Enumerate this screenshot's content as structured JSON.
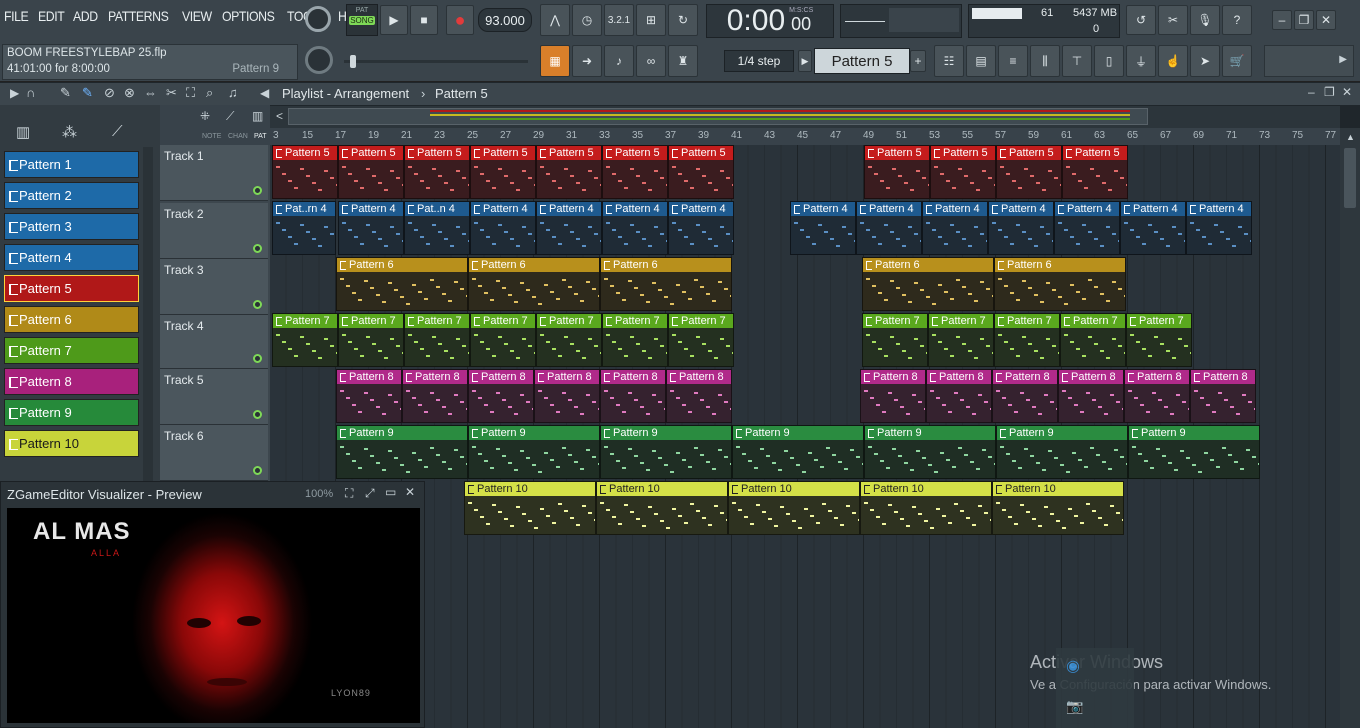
{
  "menu": [
    "FILE",
    "EDIT",
    "ADD",
    "PATTERNS",
    "VIEW",
    "OPTIONS",
    "TOOLS",
    "HELP"
  ],
  "hint": {
    "file": "BOOM FREESTYLEBAP 25.flp",
    "time": "41:01:00 for 8:00:00",
    "pattern": "Pattern 9"
  },
  "transport": {
    "pat": "PAT",
    "song": "SONG",
    "tempo": "93.000",
    "time": "0:00",
    "time_small": "00",
    "time_unit": "M:S:CS"
  },
  "monitor": {
    "cpu": "61",
    "mem": "5437 MB",
    "poly": "0"
  },
  "toolbar": {
    "step": "1/4 step",
    "pattern_sel": "Pattern 5"
  },
  "playlist": {
    "title": "Playlist - Arrangement",
    "pattern": "Pattern 5"
  },
  "side_labels": [
    "NOTE",
    "CHAN",
    "PAT"
  ],
  "patterns": [
    {
      "label": "Pattern 1",
      "color": "#1e6aa8"
    },
    {
      "label": "Pattern 2",
      "color": "#1e6aa8"
    },
    {
      "label": "Pattern 3",
      "color": "#1e6aa8"
    },
    {
      "label": "Pattern 4",
      "color": "#1e6aa8"
    },
    {
      "label": "Pattern 5",
      "color": "#b01818"
    },
    {
      "label": "Pattern 6",
      "color": "#b08a18"
    },
    {
      "label": "Pattern 7",
      "color": "#4e9a1a"
    },
    {
      "label": "Pattern 8",
      "color": "#a8217c"
    },
    {
      "label": "Pattern 9",
      "color": "#268a3a"
    },
    {
      "label": "Pattern 10",
      "color": "#c8d43a"
    }
  ],
  "tracks": [
    "Track 1",
    "Track 2",
    "Track 3",
    "Track 4",
    "Track 5",
    "Track 6"
  ],
  "ruler": [
    "3",
    "15",
    "17",
    "19",
    "21",
    "23",
    "25",
    "27",
    "29",
    "31",
    "33",
    "35",
    "37",
    "39",
    "41",
    "43",
    "45",
    "47",
    "49",
    "51",
    "53",
    "55",
    "57",
    "59",
    "61",
    "63",
    "65",
    "67",
    "69",
    "71",
    "73",
    "75",
    "77"
  ],
  "clips": {
    "p5": "Pattern 5",
    "p4": "Pattern 4",
    "p4s": "Pat..rn 4",
    "p4t": "Pat..n 4",
    "p6": "Pattern 6",
    "p7": "Pattern 7",
    "p8": "Pattern 8",
    "p9": "Pattern 9",
    "p10": "Pattern 10"
  },
  "visualizer": {
    "title": "ZGameEditor Visualizer - Preview",
    "zoom": "100%",
    "art_title": "AL MAS",
    "art_sub": "ALLA",
    "art_sign": "LYON89"
  },
  "watermark": {
    "line1": "Activar Windows",
    "line2": "Ve a Configuración para activar Windows."
  }
}
